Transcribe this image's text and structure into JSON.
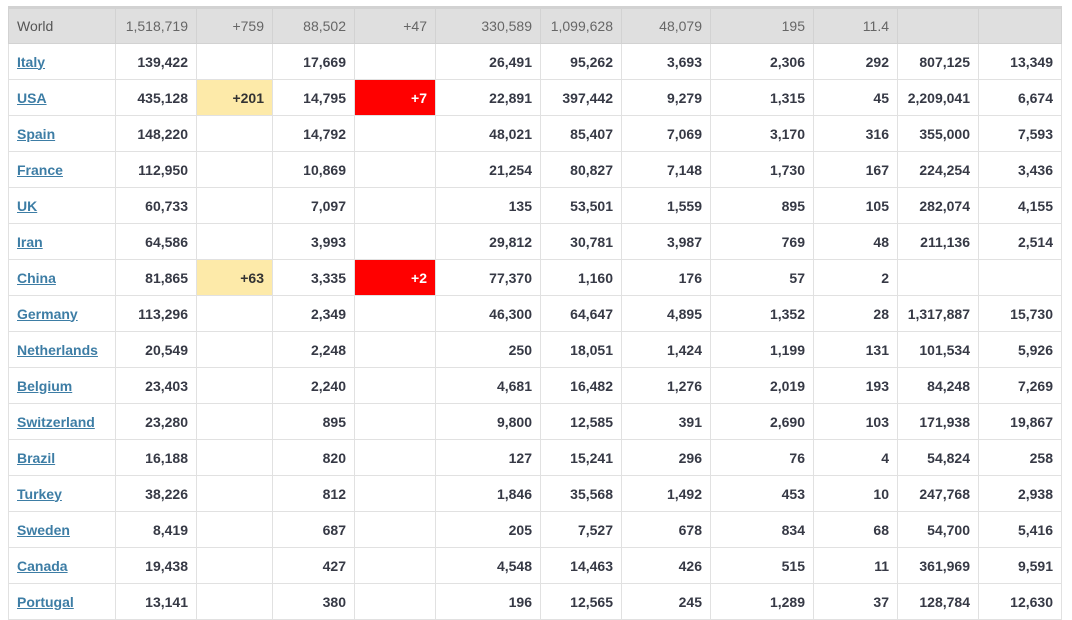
{
  "table": {
    "world": {
      "country": "World",
      "total_cases": "1,518,719",
      "new_cases": "+759",
      "total_deaths": "88,502",
      "new_deaths": "+47",
      "total_recovered": "330,589",
      "active_cases": "1,099,628",
      "serious_critical": "48,079",
      "cases_per_1m": "195",
      "deaths_per_1m": "11.4",
      "total_tests": "",
      "tests_per_1m": ""
    },
    "rows": [
      {
        "country": "Italy",
        "total_cases": "139,422",
        "new_cases": "",
        "total_deaths": "17,669",
        "new_deaths": "",
        "total_recovered": "26,491",
        "active_cases": "95,262",
        "serious_critical": "3,693",
        "cases_per_1m": "2,306",
        "deaths_per_1m": "292",
        "total_tests": "807,125",
        "tests_per_1m": "13,349"
      },
      {
        "country": "USA",
        "total_cases": "435,128",
        "new_cases": "+201",
        "total_deaths": "14,795",
        "new_deaths": "+7",
        "total_recovered": "22,891",
        "active_cases": "397,442",
        "serious_critical": "9,279",
        "cases_per_1m": "1,315",
        "deaths_per_1m": "45",
        "total_tests": "2,209,041",
        "tests_per_1m": "6,674"
      },
      {
        "country": "Spain",
        "total_cases": "148,220",
        "new_cases": "",
        "total_deaths": "14,792",
        "new_deaths": "",
        "total_recovered": "48,021",
        "active_cases": "85,407",
        "serious_critical": "7,069",
        "cases_per_1m": "3,170",
        "deaths_per_1m": "316",
        "total_tests": "355,000",
        "tests_per_1m": "7,593"
      },
      {
        "country": "France",
        "total_cases": "112,950",
        "new_cases": "",
        "total_deaths": "10,869",
        "new_deaths": "",
        "total_recovered": "21,254",
        "active_cases": "80,827",
        "serious_critical": "7,148",
        "cases_per_1m": "1,730",
        "deaths_per_1m": "167",
        "total_tests": "224,254",
        "tests_per_1m": "3,436"
      },
      {
        "country": "UK",
        "total_cases": "60,733",
        "new_cases": "",
        "total_deaths": "7,097",
        "new_deaths": "",
        "total_recovered": "135",
        "active_cases": "53,501",
        "serious_critical": "1,559",
        "cases_per_1m": "895",
        "deaths_per_1m": "105",
        "total_tests": "282,074",
        "tests_per_1m": "4,155"
      },
      {
        "country": "Iran",
        "total_cases": "64,586",
        "new_cases": "",
        "total_deaths": "3,993",
        "new_deaths": "",
        "total_recovered": "29,812",
        "active_cases": "30,781",
        "serious_critical": "3,987",
        "cases_per_1m": "769",
        "deaths_per_1m": "48",
        "total_tests": "211,136",
        "tests_per_1m": "2,514"
      },
      {
        "country": "China",
        "total_cases": "81,865",
        "new_cases": "+63",
        "total_deaths": "3,335",
        "new_deaths": "+2",
        "total_recovered": "77,370",
        "active_cases": "1,160",
        "serious_critical": "176",
        "cases_per_1m": "57",
        "deaths_per_1m": "2",
        "total_tests": "",
        "tests_per_1m": ""
      },
      {
        "country": "Germany",
        "total_cases": "113,296",
        "new_cases": "",
        "total_deaths": "2,349",
        "new_deaths": "",
        "total_recovered": "46,300",
        "active_cases": "64,647",
        "serious_critical": "4,895",
        "cases_per_1m": "1,352",
        "deaths_per_1m": "28",
        "total_tests": "1,317,887",
        "tests_per_1m": "15,730"
      },
      {
        "country": "Netherlands",
        "total_cases": "20,549",
        "new_cases": "",
        "total_deaths": "2,248",
        "new_deaths": "",
        "total_recovered": "250",
        "active_cases": "18,051",
        "serious_critical": "1,424",
        "cases_per_1m": "1,199",
        "deaths_per_1m": "131",
        "total_tests": "101,534",
        "tests_per_1m": "5,926"
      },
      {
        "country": "Belgium",
        "total_cases": "23,403",
        "new_cases": "",
        "total_deaths": "2,240",
        "new_deaths": "",
        "total_recovered": "4,681",
        "active_cases": "16,482",
        "serious_critical": "1,276",
        "cases_per_1m": "2,019",
        "deaths_per_1m": "193",
        "total_tests": "84,248",
        "tests_per_1m": "7,269"
      },
      {
        "country": "Switzerland",
        "total_cases": "23,280",
        "new_cases": "",
        "total_deaths": "895",
        "new_deaths": "",
        "total_recovered": "9,800",
        "active_cases": "12,585",
        "serious_critical": "391",
        "cases_per_1m": "2,690",
        "deaths_per_1m": "103",
        "total_tests": "171,938",
        "tests_per_1m": "19,867"
      },
      {
        "country": "Brazil",
        "total_cases": "16,188",
        "new_cases": "",
        "total_deaths": "820",
        "new_deaths": "",
        "total_recovered": "127",
        "active_cases": "15,241",
        "serious_critical": "296",
        "cases_per_1m": "76",
        "deaths_per_1m": "4",
        "total_tests": "54,824",
        "tests_per_1m": "258"
      },
      {
        "country": "Turkey",
        "total_cases": "38,226",
        "new_cases": "",
        "total_deaths": "812",
        "new_deaths": "",
        "total_recovered": "1,846",
        "active_cases": "35,568",
        "serious_critical": "1,492",
        "cases_per_1m": "453",
        "deaths_per_1m": "10",
        "total_tests": "247,768",
        "tests_per_1m": "2,938"
      },
      {
        "country": "Sweden",
        "total_cases": "8,419",
        "new_cases": "",
        "total_deaths": "687",
        "new_deaths": "",
        "total_recovered": "205",
        "active_cases": "7,527",
        "serious_critical": "678",
        "cases_per_1m": "834",
        "deaths_per_1m": "68",
        "total_tests": "54,700",
        "tests_per_1m": "5,416"
      },
      {
        "country": "Canada",
        "total_cases": "19,438",
        "new_cases": "",
        "total_deaths": "427",
        "new_deaths": "",
        "total_recovered": "4,548",
        "active_cases": "14,463",
        "serious_critical": "426",
        "cases_per_1m": "515",
        "deaths_per_1m": "11",
        "total_tests": "361,969",
        "tests_per_1m": "9,591"
      },
      {
        "country": "Portugal",
        "total_cases": "13,141",
        "new_cases": "",
        "total_deaths": "380",
        "new_deaths": "",
        "total_recovered": "196",
        "active_cases": "12,565",
        "serious_critical": "245",
        "cases_per_1m": "1,289",
        "deaths_per_1m": "37",
        "total_tests": "128,784",
        "tests_per_1m": "12,630"
      }
    ]
  },
  "colors": {
    "link": "#3d7da5",
    "world_row_bg": "#dfdfdf",
    "new_cases_highlight": "#fdeaa9",
    "new_deaths_highlight": "#ff0000"
  }
}
